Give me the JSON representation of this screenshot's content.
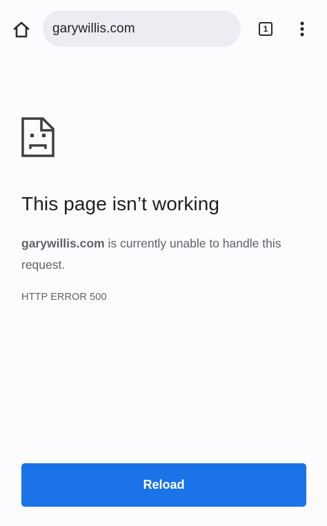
{
  "toolbar": {
    "home_icon": "home-icon",
    "url": "garywillis.com",
    "tab_count": "1",
    "menu_icon": "more-vert-icon"
  },
  "error": {
    "icon": "sad-page-icon",
    "title": "This page isn’t working",
    "host": "garywillis.com",
    "message": " is currently unable to handle this request.",
    "code": "HTTP ERROR 500"
  },
  "actions": {
    "reload_label": "Reload"
  },
  "colors": {
    "accent": "#1a73e8",
    "background": "#fcfbfd",
    "omnibox": "#eeecf2",
    "text_primary": "#1f1f1f",
    "text_secondary": "#5f6368"
  }
}
